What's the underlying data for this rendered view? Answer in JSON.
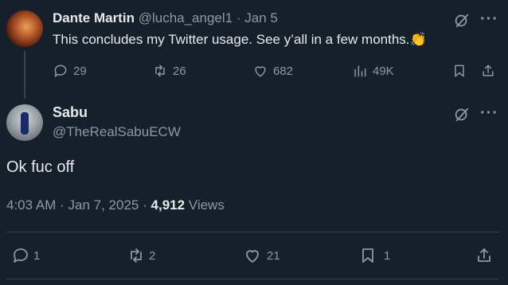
{
  "thread_tweet": {
    "display_name": "Dante Martin",
    "handle": "@lucha_angel1",
    "separator": "·",
    "date": "Jan 5",
    "text": "This concludes my Twitter usage. See y’all in a few months.",
    "emoji": "👏",
    "actions": {
      "replies": "29",
      "retweets": "26",
      "likes": "682",
      "views": "49K"
    }
  },
  "main_tweet": {
    "display_name": "Sabu",
    "handle": "@TheRealSabuECW",
    "text": "Ok fuc off",
    "time": "4:03 AM",
    "sep1": "·",
    "date": "Jan 7, 2025",
    "sep2": "·",
    "views_count": "4,912",
    "views_label": "Views",
    "actions": {
      "replies": "1",
      "retweets": "2",
      "likes": "21",
      "bookmarks": "1"
    }
  },
  "icons": {
    "grok": "grok-icon",
    "more": "more-icon",
    "reply": "reply-icon",
    "retweet": "retweet-icon",
    "like": "heart-icon",
    "views": "analytics-icon",
    "bookmark": "bookmark-icon",
    "share": "share-icon"
  },
  "colors": {
    "background": "#15202b",
    "text": "#e7e9ea",
    "muted": "#8b98a5",
    "divider": "#38444d"
  }
}
